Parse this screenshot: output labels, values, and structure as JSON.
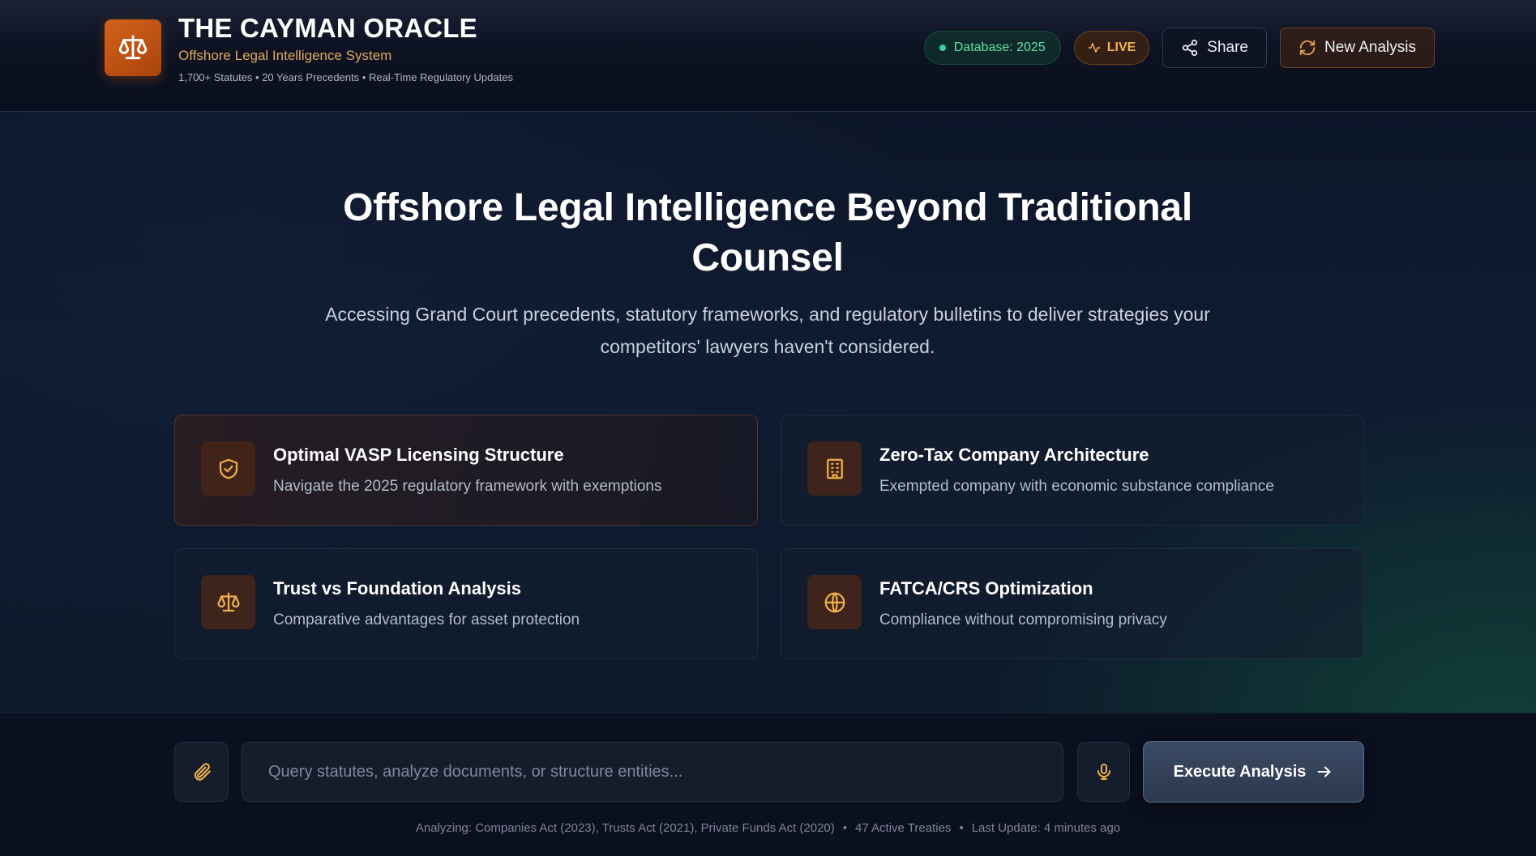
{
  "header": {
    "title": "THE CAYMAN ORACLE",
    "subtitle": "Offshore Legal Intelligence System",
    "meta": "1,700+ Statutes • 20 Years Precedents • Real-Time Regulatory Updates",
    "logo_icon": "scales-icon",
    "database_pill": "Database: 2025",
    "live_pill": "LIVE",
    "share_label": "Share",
    "new_analysis_label": "New Analysis"
  },
  "hero": {
    "title": "Offshore Legal Intelligence Beyond Traditional Counsel",
    "subtitle": "Accessing Grand Court precedents, statutory frameworks, and regulatory bulletins to deliver strategies your competitors' lawyers haven't considered."
  },
  "cards": [
    {
      "icon": "shield-check-icon",
      "title": "Optimal VASP Licensing Structure",
      "description": "Navigate the 2025 regulatory framework with exemptions"
    },
    {
      "icon": "building-icon",
      "title": "Zero-Tax Company Architecture",
      "description": "Exempted company with economic substance compliance"
    },
    {
      "icon": "scales-icon",
      "title": "Trust vs Foundation Analysis",
      "description": "Comparative advantages for asset protection"
    },
    {
      "icon": "globe-icon",
      "title": "FATCA/CRS Optimization",
      "description": "Compliance without compromising privacy"
    }
  ],
  "composer": {
    "placeholder": "Query statutes, analyze documents, or structure entities...",
    "value": "",
    "execute_label": "Execute Analysis"
  },
  "status": {
    "analyzing": "Analyzing: Companies Act (2023), Trusts Act (2021), Private Funds Act (2020)",
    "treaties": "47 Active Treaties",
    "last_update": "Last Update: 4 minutes ago",
    "separator": "•"
  },
  "colors": {
    "accent_orange": "#d4621a",
    "accent_gold": "#e2a85a",
    "live_green": "#34d399",
    "background": "#0c1426"
  }
}
